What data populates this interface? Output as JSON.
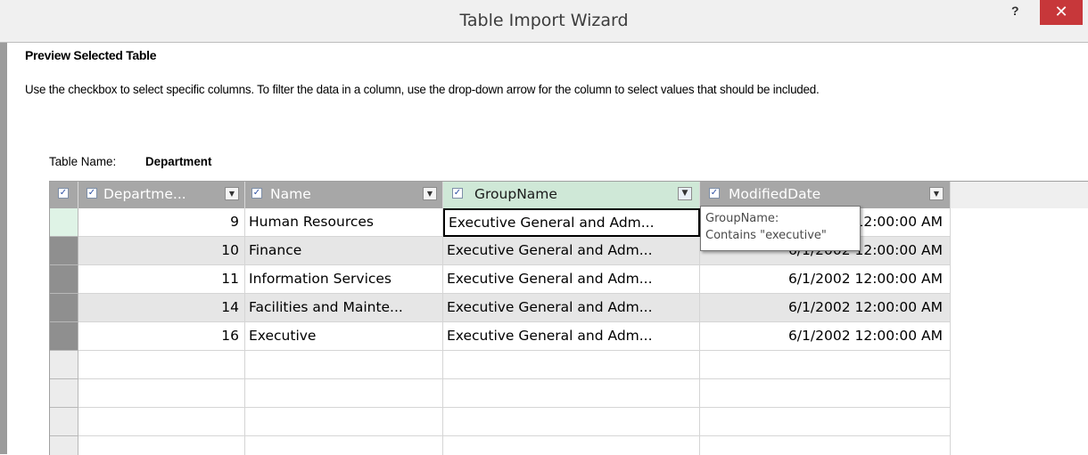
{
  "window": {
    "title": "Table Import Wizard",
    "help_label": "?",
    "close_label": "✕"
  },
  "page": {
    "heading": "Preview Selected Table",
    "instructions": "Use the checkbox to select specific columns. To filter the data in a column, use the drop-down arrow  for the column to select values that should be included.",
    "table_name_label": "Table Name:",
    "table_name": "Department"
  },
  "grid": {
    "columns": [
      {
        "label": "Departme...",
        "checked": true
      },
      {
        "label": "Name",
        "checked": true
      },
      {
        "label": "GroupName",
        "checked": true,
        "filtered": true
      },
      {
        "label": "ModifiedDate",
        "checked": true
      }
    ],
    "rows": [
      [
        "9",
        "Human Resources",
        "Executive General and Adm...",
        "6/1/2002 12:00:00 AM"
      ],
      [
        "10",
        "Finance",
        "Executive General and Adm...",
        "6/1/2002 12:00:00 AM"
      ],
      [
        "11",
        "Information Services",
        "Executive General and Adm...",
        "6/1/2002 12:00:00 AM"
      ],
      [
        "14",
        "Facilities and Mainte...",
        "Executive General and Adm...",
        "6/1/2002 12:00:00 AM"
      ],
      [
        "16",
        "Executive",
        "Executive General and Adm...",
        "6/1/2002 12:00:00 AM"
      ]
    ],
    "tooltip": {
      "line1": "GroupName:",
      "line2": "Contains \"executive\""
    }
  },
  "colors": {
    "header_bg": "#a7a7a7",
    "selected_header_bg": "#cfe8d7",
    "close_bg": "#c7373a",
    "alt_row_bg": "#e6e6e6"
  }
}
